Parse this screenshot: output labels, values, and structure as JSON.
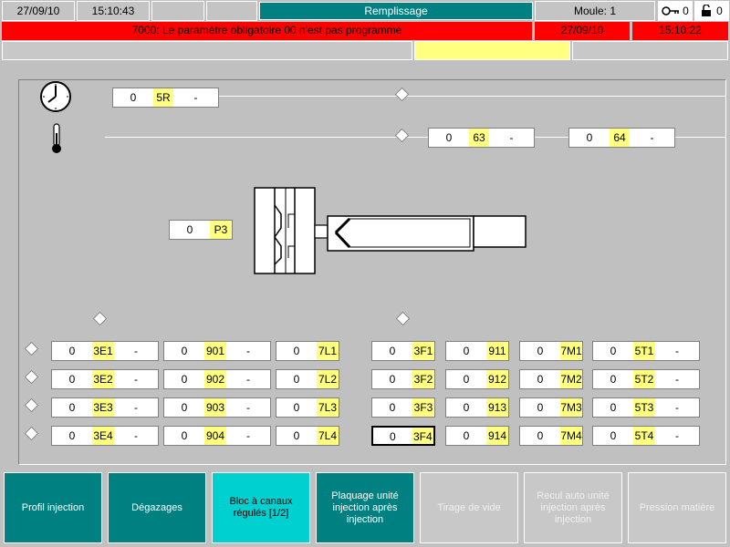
{
  "header": {
    "date": "27/09/10",
    "time": "15:10:43",
    "title": "Remplissage",
    "mould_label": "Moule: 1",
    "key_count": "0",
    "lock_count": "0"
  },
  "alarm": {
    "message": "7000: Le paramètre obligatoire 00 n'est pas programmé",
    "date": "27/09/10",
    "time": "15:10:22"
  },
  "cycle": {
    "value": "0",
    "id": "5R",
    "unit": "-"
  },
  "temp_a": {
    "value": "0",
    "id": "63",
    "unit": "-"
  },
  "temp_b": {
    "value": "0",
    "id": "64",
    "unit": "-"
  },
  "pressure": {
    "value": "0",
    "id": "P3"
  },
  "grid_left": [
    [
      {
        "value": "0",
        "id": "3E1",
        "unit": "-"
      },
      {
        "value": "0",
        "id": "901",
        "unit": "-"
      },
      {
        "value": "0",
        "id": "7L1"
      }
    ],
    [
      {
        "value": "0",
        "id": "3E2",
        "unit": "-"
      },
      {
        "value": "0",
        "id": "902",
        "unit": "-"
      },
      {
        "value": "0",
        "id": "7L2"
      }
    ],
    [
      {
        "value": "0",
        "id": "3E3",
        "unit": "-"
      },
      {
        "value": "0",
        "id": "903",
        "unit": "-"
      },
      {
        "value": "0",
        "id": "7L3"
      }
    ],
    [
      {
        "value": "0",
        "id": "3E4",
        "unit": "-"
      },
      {
        "value": "0",
        "id": "904",
        "unit": "-"
      },
      {
        "value": "0",
        "id": "7L4"
      }
    ]
  ],
  "grid_right": [
    [
      {
        "value": "0",
        "id": "3F1"
      },
      {
        "value": "0",
        "id": "911"
      },
      {
        "value": "0",
        "id": "7M1"
      },
      {
        "value": "0",
        "id": "5T1",
        "unit": "-"
      }
    ],
    [
      {
        "value": "0",
        "id": "3F2"
      },
      {
        "value": "0",
        "id": "912"
      },
      {
        "value": "0",
        "id": "7M2"
      },
      {
        "value": "0",
        "id": "5T2",
        "unit": "-"
      }
    ],
    [
      {
        "value": "0",
        "id": "3F3"
      },
      {
        "value": "0",
        "id": "913"
      },
      {
        "value": "0",
        "id": "7M3"
      },
      {
        "value": "0",
        "id": "5T3",
        "unit": "-"
      }
    ],
    [
      {
        "value": "0",
        "id": "3F4"
      },
      {
        "value": "0",
        "id": "914"
      },
      {
        "value": "0",
        "id": "7M4"
      },
      {
        "value": "0",
        "id": "5T4",
        "unit": "-"
      }
    ]
  ],
  "buttons": [
    {
      "label": "Profil injection",
      "state": "active"
    },
    {
      "label": "Dégazages",
      "state": "active"
    },
    {
      "label": "Bloc à canaux régulés [1/2]",
      "state": "selected"
    },
    {
      "label": "Plaquage unité injection après injection",
      "state": "active"
    },
    {
      "label": "Tirage de vide",
      "state": "disabled"
    },
    {
      "label": "Recul auto unité injection après injection",
      "state": "disabled"
    },
    {
      "label": "Pression matière",
      "state": "disabled"
    }
  ],
  "colors": {
    "title_bar": "#008080",
    "alarm": "#ff0000",
    "field_id": "#ffff80",
    "button_teal": "#008080",
    "button_cyan": "#00d0d0"
  },
  "icons": {
    "clock": "clock-icon",
    "thermometer": "thermometer-icon",
    "key": "key-icon",
    "lock": "lock-icon"
  }
}
